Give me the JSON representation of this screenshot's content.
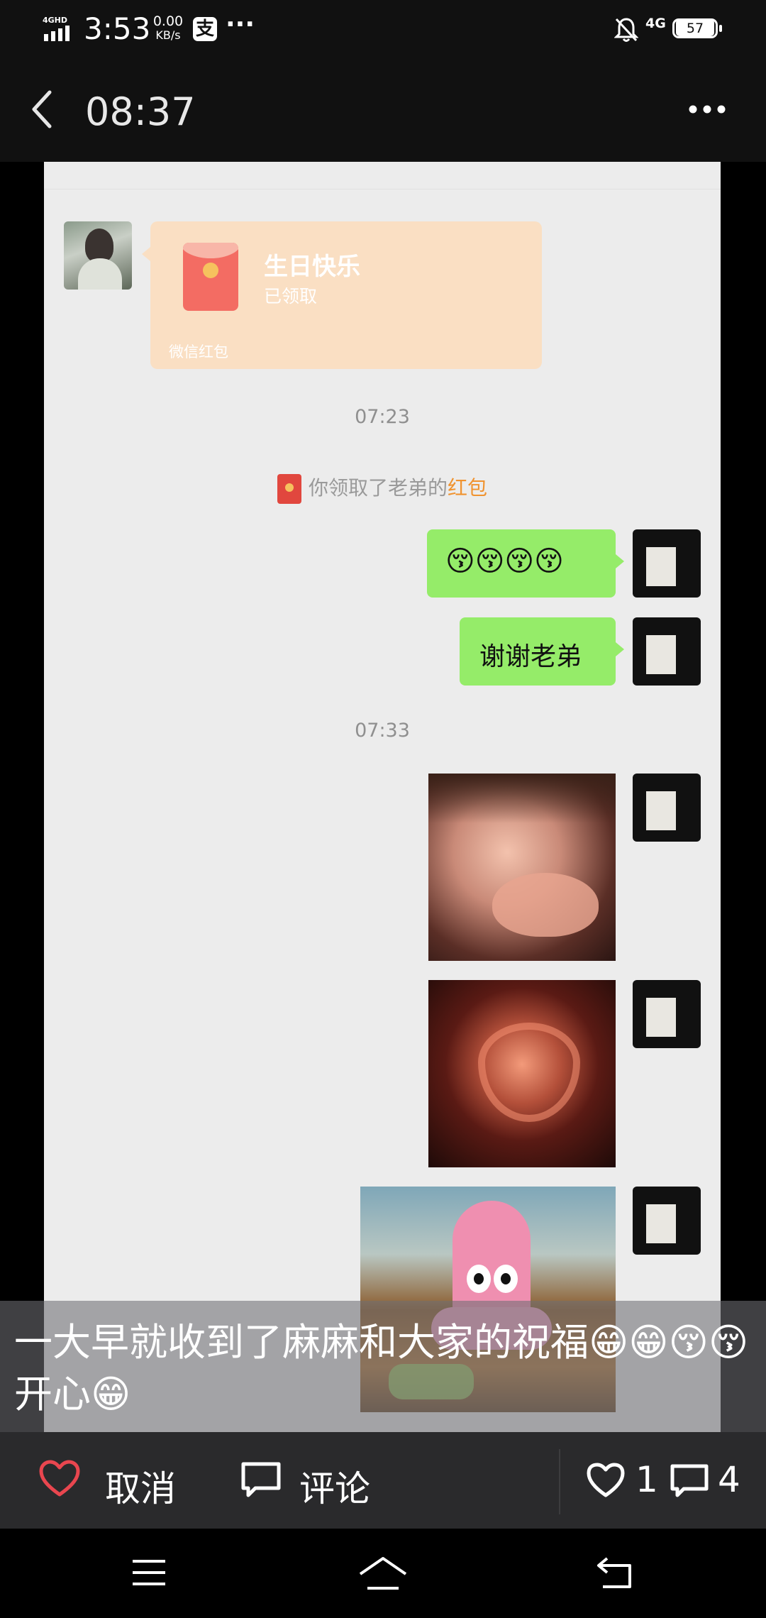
{
  "status_bar": {
    "network": "4GHD",
    "time": "3:53",
    "speed_value": "0.00",
    "speed_unit": "KB/s",
    "app_icon_char": "支",
    "more": "···",
    "mobile": "4G",
    "battery": "57"
  },
  "header": {
    "title": "08:37"
  },
  "chat": {
    "red_packet": {
      "title": "生日快乐",
      "status": "已领取",
      "footer": "微信红包"
    },
    "time1": "07:23",
    "system_msg_prefix": "你领取了老弟的",
    "system_msg_link": "红包",
    "msg_emoji": "😚😚😚😚",
    "msg_thanks": "谢谢老弟",
    "time2": "07:33"
  },
  "post": {
    "caption": "一大早就收到了麻麻和大家的祝福😁😁😚😚开心😁"
  },
  "actions": {
    "cancel_label": "取消",
    "comment_label": "评论",
    "like_count": "1",
    "comment_count": "4"
  },
  "colors": {
    "wechat_green": "#95ec69",
    "red_packet_bg": "#fadfc3",
    "link_orange": "#f0932f",
    "heart_red": "#e9464f"
  }
}
